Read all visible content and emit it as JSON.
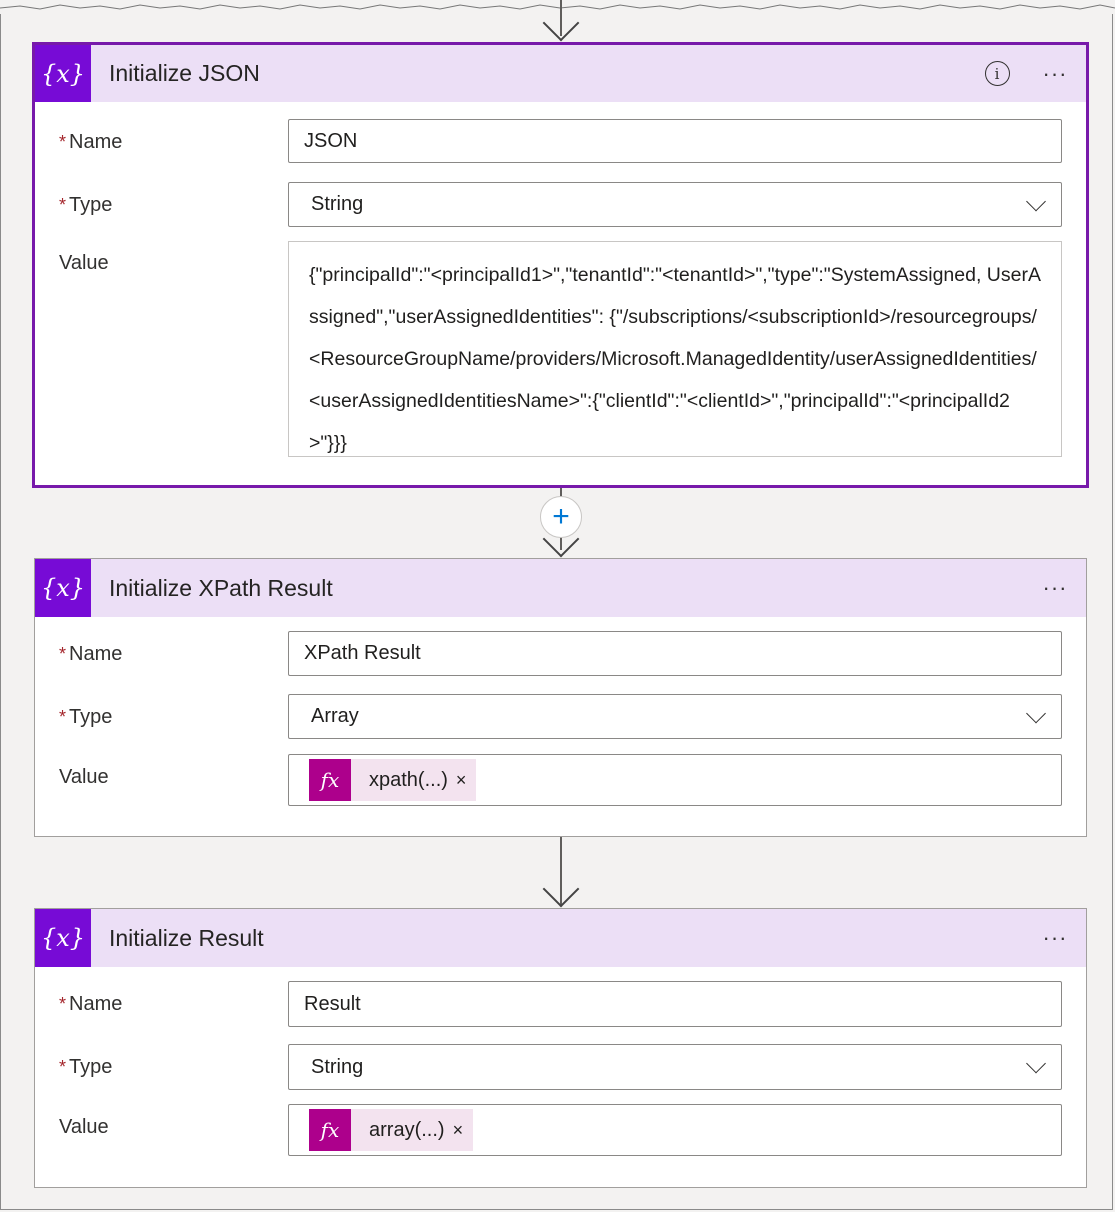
{
  "cards": [
    {
      "title": "Initialize JSON",
      "name_label": "Name",
      "name_value": "JSON",
      "type_label": "Type",
      "type_value": "String",
      "value_label": "Value",
      "value_text": "{\"principalId\":\"<principalId1>\",\"tenantId\":\"<tenantId>\",\"type\":\"SystemAssigned, UserAssigned\",\"userAssignedIdentities\": {\"/subscriptions/<subscriptionId>/resourcegroups/<ResourceGroupName/providers/Microsoft.ManagedIdentity/userAssignedIdentities/<userAssignedIdentitiesName>\":{\"clientId\":\"<clientId>\",\"principalId\":\"<principalId2>\"}}}"
    },
    {
      "title": "Initialize XPath Result",
      "name_label": "Name",
      "name_value": "XPath Result",
      "type_label": "Type",
      "type_value": "Array",
      "value_label": "Value",
      "token": "xpath(...)"
    },
    {
      "title": "Initialize Result",
      "name_label": "Name",
      "name_value": "Result",
      "type_label": "Type",
      "type_value": "String",
      "value_label": "Value",
      "token": "array(...)"
    }
  ],
  "required_mark": "*",
  "icons": {
    "variable": "{x}",
    "function": "fx",
    "more": "···",
    "info": "i",
    "remove": "×",
    "add": "+"
  },
  "colors": {
    "header_bg": "#ecdff6",
    "variable_icon": "#770bd6",
    "selected_border": "#7719aa",
    "function_icon": "#ad008c",
    "token_bg": "#f3e3ef",
    "plus": "#0078d4"
  }
}
